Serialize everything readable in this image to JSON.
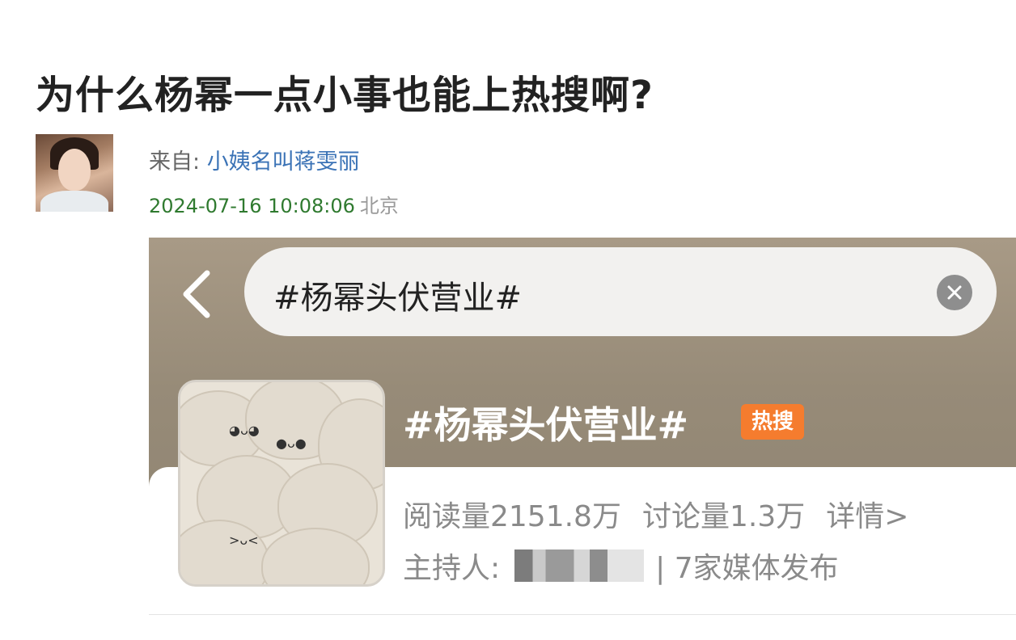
{
  "post": {
    "title": "为什么杨幂一点小事也能上热搜啊?",
    "from_label": "来自: ",
    "author": "小姨名叫蒋雯丽",
    "datetime": "2024-07-16 10:08:06",
    "location": "北京"
  },
  "screenshot": {
    "search_query": "#杨幂头伏营业#",
    "topic_title": "#杨幂头伏营业#",
    "badge": "热搜",
    "read_count": "阅读量2151.8万",
    "discussion_count": "讨论量1.3万",
    "details_link": "详情>",
    "host_label": "主持人:",
    "media_count": "| 7家媒体发布",
    "icons": {
      "back": "chevron-left-icon",
      "clear": "clear-icon"
    },
    "colors": {
      "badge": "#f57c2e",
      "header_bg": "#a89a86"
    }
  }
}
